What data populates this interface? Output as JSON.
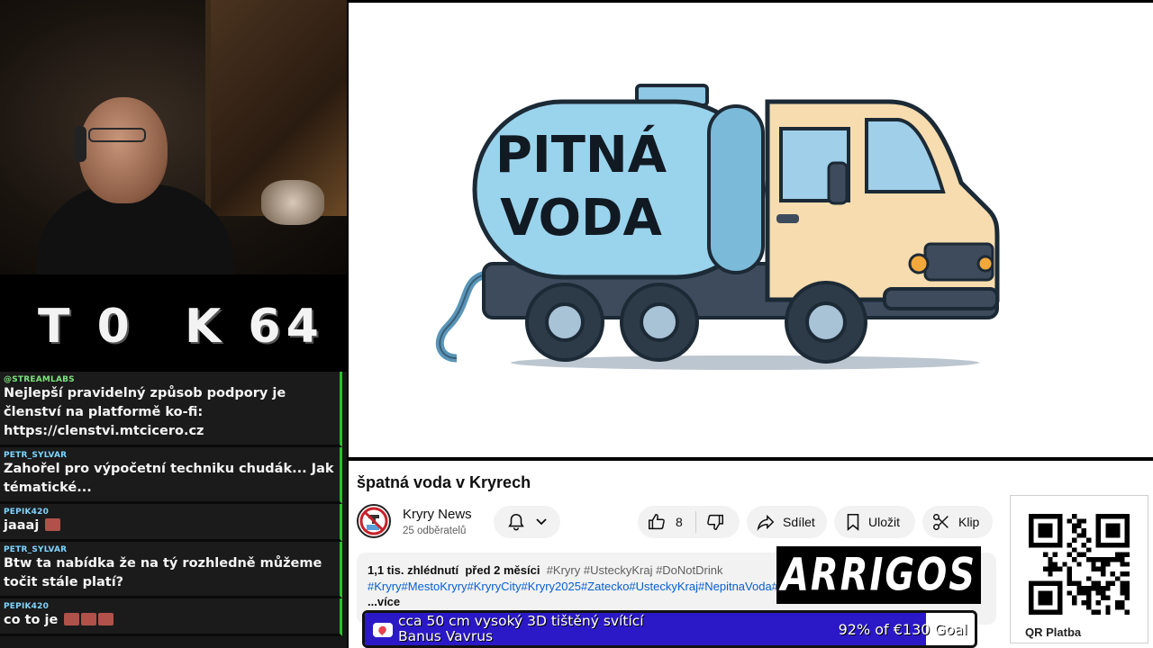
{
  "scoreboard": {
    "left": "T 0",
    "right": "K 64"
  },
  "chat": [
    {
      "user": "@STREAMLABS",
      "text": "Nejlepší pravidelný způsob podpory je členství na platformě ko-fi: https://clenstvi.mtcicero.cz",
      "emotes": 0
    },
    {
      "user": "PETR_SYLVAR",
      "text": "Zahořel pro výpočetní techniku chudák... Jak tématické...",
      "emotes": 0
    },
    {
      "user": "PEPIK420",
      "text": "jaaaj",
      "emotes": 1
    },
    {
      "user": "PETR_SYLVAR",
      "text": "Btw ta nabídka že na tý rozhledně můžeme točit stále platí?",
      "emotes": 0
    },
    {
      "user": "PEPIK420",
      "text": "co to je",
      "emotes": 3
    }
  ],
  "video": {
    "thumbnail_text_line1": "PITNÁ",
    "thumbnail_text_line2": "VODA",
    "title": "špatná voda v Kryrech"
  },
  "channel": {
    "name": "Kryry News",
    "subscribers": "25 odběratelů",
    "bell_icon": "bell-icon",
    "avatar_icon": "no-water-icon"
  },
  "actions": {
    "like_count": "8",
    "share_label": "Sdílet",
    "save_label": "Uložit",
    "clip_label": "Klip"
  },
  "description": {
    "views": "1,1 tis. zhlédnutí",
    "date": "před 2 měsíci",
    "hashtags_top": "#Kryry #UsteckyKraj #DoNotDrink",
    "hashtags_line": "#Kryry#MestoKryry#KryryCity#Kryry2025#Zatecko#UsteckyKraj#NepitnaVoda#Zate",
    "more_label": "...více"
  },
  "sponsor": {
    "name": "ARRIGOS"
  },
  "qr": {
    "label": "QR Platba"
  },
  "goal": {
    "title_line1": "cca 50 cm vysoký 3D tištěný svítící",
    "title_line2": "Banus Vavrus",
    "amount": "92% of €130 Goal",
    "progress": 0.92,
    "fill_color": "#2b19c7"
  },
  "colors": {
    "chat_border": "#27c127",
    "link": "#065fd4",
    "truck_tank": "#9ad3ec",
    "truck_cab": "#f6dcae"
  }
}
